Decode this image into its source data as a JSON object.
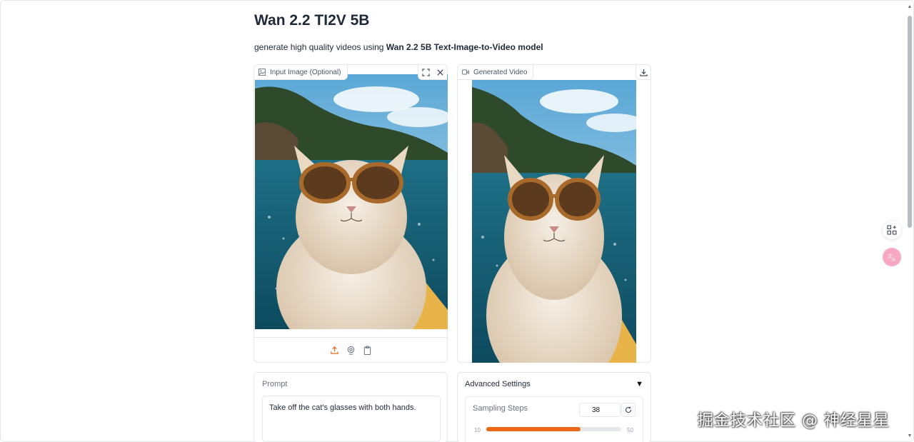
{
  "app": {
    "title": "Wan 2.2 TI2V 5B",
    "subtitle_prefix": "generate high quality videos using ",
    "subtitle_bold": "Wan 2.2 5B Text-Image-to-Video model"
  },
  "input_image": {
    "label": "Input Image (Optional)",
    "icons": [
      "image-icon",
      "fullscreen-icon",
      "close-icon",
      "upload-icon",
      "webcam-icon",
      "clipboard-icon"
    ]
  },
  "generated_video": {
    "label": "Generated Video",
    "icons": [
      "video-icon",
      "download-icon"
    ]
  },
  "prompt": {
    "label": "Prompt",
    "value": "Take off the cat's glasses with both hands."
  },
  "advanced_settings": {
    "label": "Advanced Settings",
    "toggle_icon": "▼",
    "sampling_steps": {
      "label": "Sampling Steps",
      "value": "38",
      "min": "10",
      "max": "50",
      "fraction": 0.7
    }
  },
  "watermark": "掘金技术社区 @ 神经星星",
  "colors": {
    "accent": "#ea6a1a",
    "border": "#e5e7eb",
    "translate_button": "#f9a8c2"
  }
}
